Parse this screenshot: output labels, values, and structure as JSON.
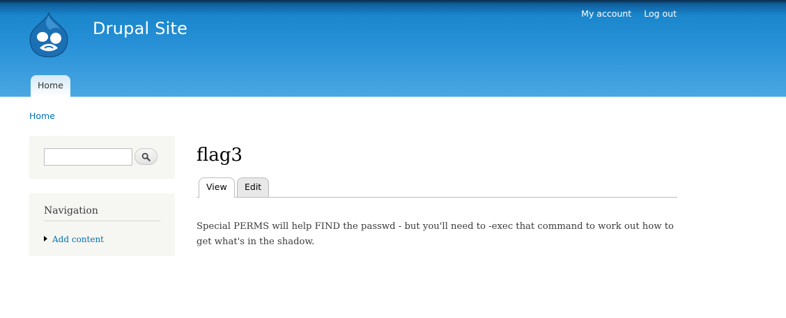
{
  "header": {
    "site_name": "Drupal Site",
    "logo": "drupal-drop-logo",
    "secondary_menu": [
      "My account",
      "Log out"
    ],
    "main_menu": [
      "Home"
    ]
  },
  "breadcrumb": "Home",
  "sidebar": {
    "search": {
      "value": "",
      "button_icon": "search-icon"
    },
    "navigation": {
      "title": "Navigation",
      "items": [
        "Add content"
      ]
    }
  },
  "content": {
    "title": "flag3",
    "tabs": [
      "View",
      "Edit"
    ],
    "active_tab": "View",
    "body": "Special PERMS will help FIND the passwd - but you'll need to -exec that command to work out how to get what's in the shadow."
  },
  "colors": {
    "header_blue": "#1a86cc",
    "link": "#0071b3",
    "sidebar_bg": "#f6f6f2"
  }
}
